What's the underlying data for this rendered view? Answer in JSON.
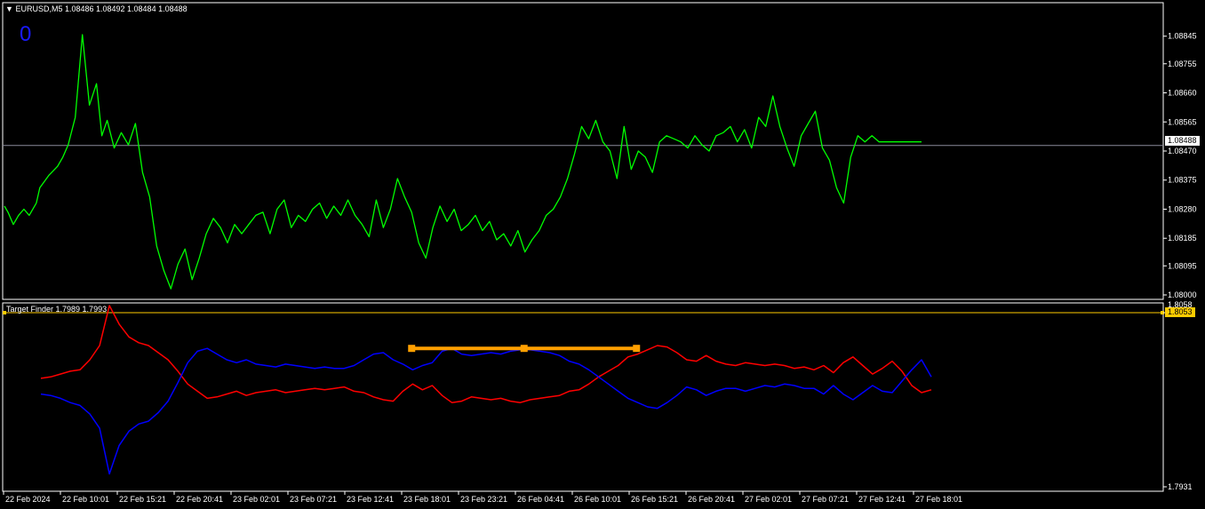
{
  "header": {
    "symbol": "EURUSD,M5",
    "ohlc": "1.08486 1.08492 1.08484 1.08488",
    "counter": "0"
  },
  "indicator": {
    "title": "Target Finder 1.7989 1.7993",
    "level_label": "1.8053",
    "bottom_label": "1.7931",
    "top_partial_label": "1.8058"
  },
  "colors": {
    "background": "#000000",
    "price": "#00ff00",
    "red_line": "#ff0000",
    "blue_line": "#0000ff",
    "level": "#ffcc00",
    "target_bar": "#ffa000",
    "frame": "#ffffff"
  },
  "chart_data": [
    {
      "type": "line",
      "series": [
        {
          "name": "EURUSD,M5"
        }
      ],
      "current_price": 1.08488,
      "current_price_label": "1.08488",
      "ylim": [
        1.08,
        1.0894
      ],
      "yticks": [
        {
          "value": 1.08845,
          "label": "1.08845"
        },
        {
          "value": 1.08755,
          "label": "1.08755"
        },
        {
          "value": 1.0866,
          "label": "1.08660"
        },
        {
          "value": 1.08565,
          "label": "1.08565"
        },
        {
          "value": 1.0847,
          "label": "1.08470"
        },
        {
          "value": 1.08375,
          "label": "1.08375"
        },
        {
          "value": 1.0828,
          "label": "1.08280"
        },
        {
          "value": 1.08185,
          "label": "1.08185"
        },
        {
          "value": 1.08095,
          "label": "1.08095"
        },
        {
          "value": 1.08,
          "label": "1.08000"
        }
      ],
      "xticks": [
        "22 Feb 2024",
        "22 Feb 10:01",
        "22 Feb 15:21",
        "22 Feb 20:41",
        "23 Feb 02:01",
        "23 Feb 07:21",
        "23 Feb 12:41",
        "23 Feb 18:01",
        "23 Feb 23:21",
        "26 Feb 04:41",
        "26 Feb 10:01",
        "26 Feb 15:21",
        "26 Feb 20:41",
        "27 Feb 02:01",
        "27 Feb 07:21",
        "27 Feb 12:41",
        "27 Feb 18:01"
      ],
      "x_index": [
        0,
        2,
        5,
        8,
        11,
        14,
        18,
        20,
        25,
        30,
        33,
        36,
        40,
        44,
        48,
        52,
        55,
        58,
        62,
        66,
        70,
        74,
        78,
        82,
        86,
        90,
        94,
        98,
        102,
        106,
        110,
        114,
        118,
        122,
        126,
        130,
        134,
        138,
        142,
        146,
        150,
        154,
        158,
        162,
        166,
        170,
        174,
        178,
        182,
        186,
        190,
        194,
        198,
        202,
        206,
        210,
        214,
        218,
        222,
        226,
        230,
        234,
        238,
        242,
        246,
        250,
        254,
        258,
        262,
        266,
        270,
        274,
        278,
        282,
        286,
        290,
        294,
        298,
        302,
        306,
        310,
        314,
        318,
        322,
        326,
        330,
        334,
        338,
        342,
        346,
        350,
        354,
        358,
        362,
        366,
        370,
        374,
        378,
        382,
        386,
        390,
        394,
        398,
        402,
        406,
        410,
        414,
        418,
        422,
        426,
        430,
        434,
        438,
        442,
        446,
        450,
        454,
        458,
        462,
        466,
        470,
        474,
        478,
        482,
        486,
        490,
        494,
        498,
        502,
        506,
        510,
        514,
        518,
        522
      ],
      "y": [
        1.0829,
        1.0827,
        1.0823,
        1.0826,
        1.0828,
        1.0826,
        1.083,
        1.0835,
        1.0839,
        1.0842,
        1.0845,
        1.0849,
        1.0858,
        1.0885,
        1.0862,
        1.0869,
        1.0852,
        1.0857,
        1.0848,
        1.0853,
        1.0849,
        1.0856,
        1.084,
        1.0832,
        1.0816,
        1.0808,
        1.0802,
        1.081,
        1.0815,
        1.0805,
        1.0812,
        1.082,
        1.0825,
        1.0822,
        1.0817,
        1.0823,
        1.082,
        1.0823,
        1.0826,
        1.0827,
        1.082,
        1.0828,
        1.0831,
        1.0822,
        1.0826,
        1.0824,
        1.0828,
        1.083,
        1.0825,
        1.0829,
        1.0826,
        1.0831,
        1.0826,
        1.0823,
        1.0819,
        1.0831,
        1.0822,
        1.0828,
        1.0838,
        1.0832,
        1.0827,
        1.0817,
        1.0812,
        1.0822,
        1.0829,
        1.0824,
        1.0828,
        1.0821,
        1.0823,
        1.0826,
        1.0821,
        1.0824,
        1.0818,
        1.082,
        1.0816,
        1.0821,
        1.0814,
        1.0818,
        1.0821,
        1.0826,
        1.0828,
        1.0832,
        1.0838,
        1.0846,
        1.0855,
        1.0851,
        1.0857,
        1.085,
        1.0847,
        1.0838,
        1.0855,
        1.0841,
        1.0847,
        1.0845,
        1.084,
        1.085,
        1.0852,
        1.0851,
        1.085,
        1.0848,
        1.0852,
        1.0849,
        1.0847,
        1.0852,
        1.0853,
        1.0855,
        1.085,
        1.0854,
        1.0848,
        1.0858,
        1.0855,
        1.0865,
        1.0855,
        1.0848,
        1.0842,
        1.0852,
        1.0856,
        1.086,
        1.0848,
        1.0844,
        1.0835,
        1.083,
        1.0845,
        1.0852,
        1.085,
        1.0852,
        1.085,
        1.085,
        1.085,
        1.085,
        1.085,
        1.085,
        1.085
      ]
    },
    {
      "type": "line",
      "ylim": [
        1.7931,
        1.8058
      ],
      "yticks": [
        {
          "value": 1.8053,
          "label": "1.8053"
        },
        {
          "value": 1.7931,
          "label": "1.7931"
        }
      ],
      "level": 1.8053,
      "target_segment": {
        "x_start": 230,
        "x_end": 357,
        "value": 1.8028
      },
      "series": [
        {
          "name": "red",
          "y": [
            1.8007,
            1.8008,
            1.801,
            1.8012,
            1.8013,
            1.802,
            1.803,
            1.8058,
            1.8045,
            1.8036,
            1.8032,
            1.803,
            1.8025,
            1.802,
            1.8012,
            1.8003,
            1.7998,
            1.7993,
            1.7994,
            1.7996,
            1.7998,
            1.7995,
            1.7997,
            1.7998,
            1.7999,
            1.7997,
            1.7998,
            1.7999,
            1.8,
            1.7999,
            1.8,
            1.8001,
            1.7998,
            1.7997,
            1.7994,
            1.7992,
            1.7991,
            1.7998,
            1.8003,
            1.7999,
            1.8002,
            1.7995,
            1.799,
            1.7991,
            1.7994,
            1.7993,
            1.7992,
            1.7993,
            1.7991,
            1.799,
            1.7992,
            1.7993,
            1.7994,
            1.7995,
            1.7998,
            1.7999,
            1.8003,
            1.8008,
            1.8012,
            1.8016,
            1.8022,
            1.8024,
            1.8027,
            1.803,
            1.8029,
            1.8025,
            1.802,
            1.8019,
            1.8023,
            1.8019,
            1.8017,
            1.8016,
            1.8018,
            1.8017,
            1.8016,
            1.8017,
            1.8016,
            1.8014,
            1.8015,
            1.8013,
            1.8016,
            1.8011,
            1.8018,
            1.8022,
            1.8016,
            1.801,
            1.8014,
            1.8019,
            1.8012,
            1.8002,
            1.7997,
            1.7999
          ]
        },
        {
          "name": "blue",
          "y": [
            1.7996,
            1.7995,
            1.7993,
            1.799,
            1.7988,
            1.7982,
            1.7972,
            1.794,
            1.796,
            1.797,
            1.7975,
            1.7977,
            1.7983,
            1.7991,
            1.8004,
            1.8018,
            1.8026,
            1.8028,
            1.8024,
            1.802,
            1.8018,
            1.802,
            1.8017,
            1.8016,
            1.8015,
            1.8017,
            1.8016,
            1.8015,
            1.8014,
            1.8015,
            1.8014,
            1.8014,
            1.8016,
            1.802,
            1.8024,
            1.8025,
            1.802,
            1.8017,
            1.8013,
            1.8016,
            1.8018,
            1.8026,
            1.8028,
            1.8024,
            1.8023,
            1.8024,
            1.8025,
            1.8024,
            1.8026,
            1.8027,
            1.8027,
            1.8026,
            1.8025,
            1.8023,
            1.8019,
            1.8017,
            1.8013,
            1.8008,
            1.8003,
            1.7998,
            1.7993,
            1.799,
            1.7987,
            1.7986,
            1.799,
            1.7995,
            1.8001,
            1.7999,
            1.7995,
            1.7998,
            1.8,
            1.8,
            1.7998,
            1.8,
            1.8002,
            1.8001,
            1.8003,
            1.8002,
            1.8,
            1.8,
            1.7996,
            1.8002,
            1.7996,
            1.7992,
            1.7997,
            1.8002,
            1.7998,
            1.7997,
            1.8005,
            1.8013,
            1.802,
            1.8008
          ]
        }
      ]
    }
  ]
}
